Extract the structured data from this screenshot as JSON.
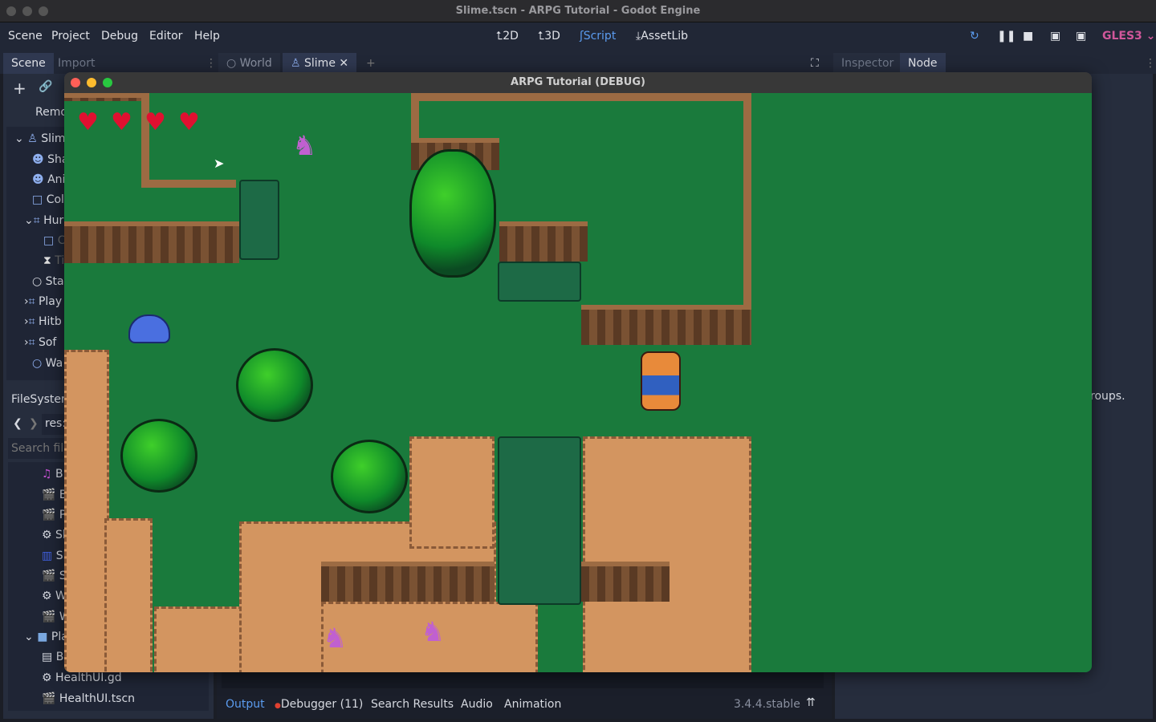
{
  "window": {
    "title": "Slime.tscn - ARPG Tutorial - Godot Engine"
  },
  "menu": [
    "Scene",
    "Project",
    "Debug",
    "Editor",
    "Help"
  ],
  "modes": {
    "2d": "2D",
    "3d": "3D",
    "script": "Script",
    "assetlib": "AssetLib"
  },
  "renderer": "GLES3",
  "left_tabs": {
    "scene": "Scene",
    "import": "Import"
  },
  "scene_tabs": {
    "world": "World",
    "slime": "Slime"
  },
  "right_tabs": {
    "inspector": "Inspector",
    "node": "Node"
  },
  "scene_toolbar": {
    "remote": "Remo"
  },
  "tree": [
    "Slime",
    "Sha",
    "Ani",
    "Col",
    "Hur",
    "C",
    "Ti",
    "Stat",
    "Play",
    "Hitb",
    "Sof",
    "Wa"
  ],
  "filesystem": {
    "title": "FileSystem",
    "path": "res:",
    "search_placeholder": "Search file",
    "items": [
      "B",
      "B",
      "P",
      "Sl",
      "Sl",
      "Sl",
      "W",
      "W",
      "Play",
      "B",
      "HealthUI.gd",
      "HealthUI.tscn"
    ]
  },
  "node_panel_text": "roups.",
  "bottom": {
    "output": "Output",
    "debugger": "Debugger (11)",
    "search": "Search Results",
    "audio": "Audio",
    "animation": "Animation",
    "version": "3.4.4.stable"
  },
  "game": {
    "title": "ARPG Tutorial (DEBUG)",
    "hearts": 4
  },
  "colors": {
    "accent": "#5b9cf0",
    "renderer": "#d0579a",
    "debug_red": "#ff5f57",
    "debug_yellow": "#febc2e",
    "debug_green": "#28c840"
  }
}
